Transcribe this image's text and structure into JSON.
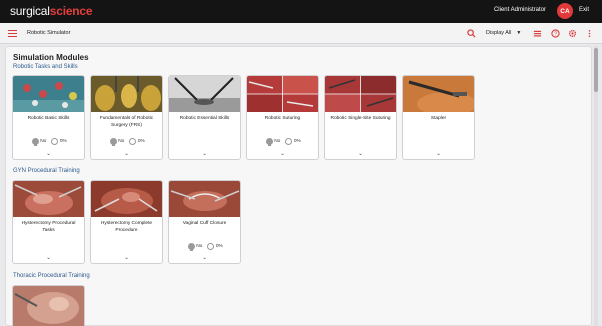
{
  "brand": {
    "part1": "surgical",
    "part2": "science"
  },
  "user": {
    "name": "Client Administrator",
    "initials": "CA",
    "exit_label": "Exit"
  },
  "toolbar": {
    "title": "Robotic Simulator",
    "display_label": "Display All"
  },
  "panel": {
    "title": "Simulation Modules"
  },
  "sections": [
    {
      "title": "Robotic Tasks and Skills",
      "cards": [
        {
          "label": "Robotic Basic Skills",
          "status_text": "No",
          "progress": "0%"
        },
        {
          "label": "Fundamentals of Robotic Surgery (FRS)",
          "status_text": "No",
          "progress": "0%"
        },
        {
          "label": "Robotic Essential Skills"
        },
        {
          "label": "Robotic Suturing",
          "status_text": "No",
          "progress": "0%"
        },
        {
          "label": "Robotic Single-Site Suturing"
        },
        {
          "label": "Stapler"
        }
      ]
    },
    {
      "title": "GYN Procedural Training",
      "cards": [
        {
          "label": "Hysterectomy Procedural Tasks"
        },
        {
          "label": "Hysterectomy Complete Procedure"
        },
        {
          "label": "Vaginal Cuff Closure",
          "status_text": "No",
          "progress": "0%"
        }
      ]
    },
    {
      "title": "Thoracic Procedural Training",
      "cards": [
        {}
      ]
    }
  ],
  "colors": {
    "accent": "#d83a3a",
    "section_title": "#2d5a8c",
    "topbar": "#141414"
  },
  "icons": [
    "menu-icon",
    "search-icon",
    "list-icon",
    "help-icon",
    "gear-icon",
    "more-vertical-icon",
    "chevron-down-icon",
    "medal-icon",
    "progress-ring-icon"
  ]
}
